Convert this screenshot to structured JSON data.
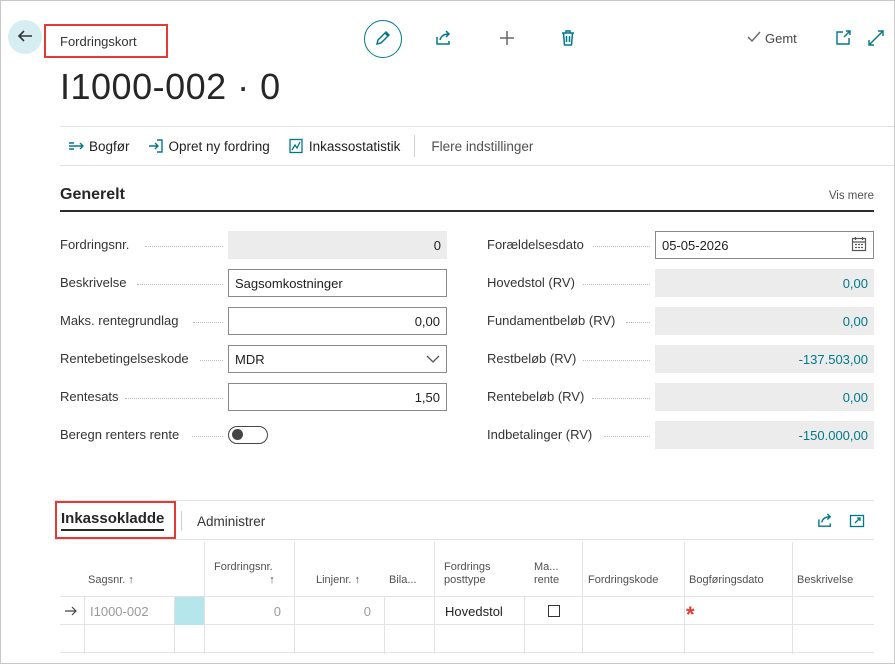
{
  "page": {
    "type_label": "Fordringskort",
    "title": "I1000-002 · 0",
    "saved_label": "Gemt"
  },
  "icons": {
    "back": "arrow-left-icon",
    "edit": "pencil-icon",
    "share": "share-icon",
    "new": "plus-icon",
    "delete": "trash-icon",
    "saved": "checkmark-icon",
    "open_new_window": "open-in-new-window-icon",
    "expand": "expand-icon"
  },
  "actions": {
    "post": "Bogfør",
    "create_new": "Opret ny fordring",
    "statistics": "Inkassostatistik",
    "more_options": "Flere indstillinger"
  },
  "general": {
    "title": "Generelt",
    "show_more": "Vis mere",
    "left": [
      {
        "label": "Fordringsnr.",
        "value": "0"
      },
      {
        "label": "Beskrivelse",
        "value": "Sagsomkostninger"
      },
      {
        "label": "Maks. rentegrundlag",
        "value": "0,00"
      },
      {
        "label": "Rentebetingelseskode",
        "value": "MDR"
      },
      {
        "label": "Rentesats",
        "value": "1,50"
      },
      {
        "label": "Beregn renters rente",
        "value": false
      }
    ],
    "right": [
      {
        "label": "Forældelsesdato",
        "value": "05-05-2026"
      },
      {
        "label": "Hovedstol (RV)",
        "value": "0,00"
      },
      {
        "label": "Fundamentbeløb (RV)",
        "value": "0,00"
      },
      {
        "label": "Restbeløb (RV)",
        "value": "-137.503,00"
      },
      {
        "label": "Rentebeløb (RV)",
        "value": "0,00"
      },
      {
        "label": "Indbetalinger (RV)",
        "value": "-150.000,00"
      }
    ]
  },
  "part": {
    "title": "Inkassokladde",
    "manage": "Administrer",
    "columns": {
      "case_no": "Sagsnr. ↑",
      "claim_no_1": "Fordringsnr.",
      "claim_no_2": "↑",
      "line_no": "Linjenr. ↑",
      "attach": "Bila...",
      "posting_type_1": "Fordrings",
      "posting_type_2": "posttype",
      "max_interest_1": "Ma...",
      "max_interest_2": "rente",
      "claim_code": "Fordringskode",
      "posting_date": "Bogføringsdato",
      "description": "Beskrivelse"
    },
    "rows": [
      {
        "case_no": "I1000-002",
        "claim_no": "0",
        "line_no": "0",
        "posting_type": "Hovedstol",
        "required_marker": "*"
      }
    ]
  },
  "colors": {
    "accent": "#00788a",
    "highlight_red": "#e53935",
    "selected_cell": "#b5e6ec"
  }
}
